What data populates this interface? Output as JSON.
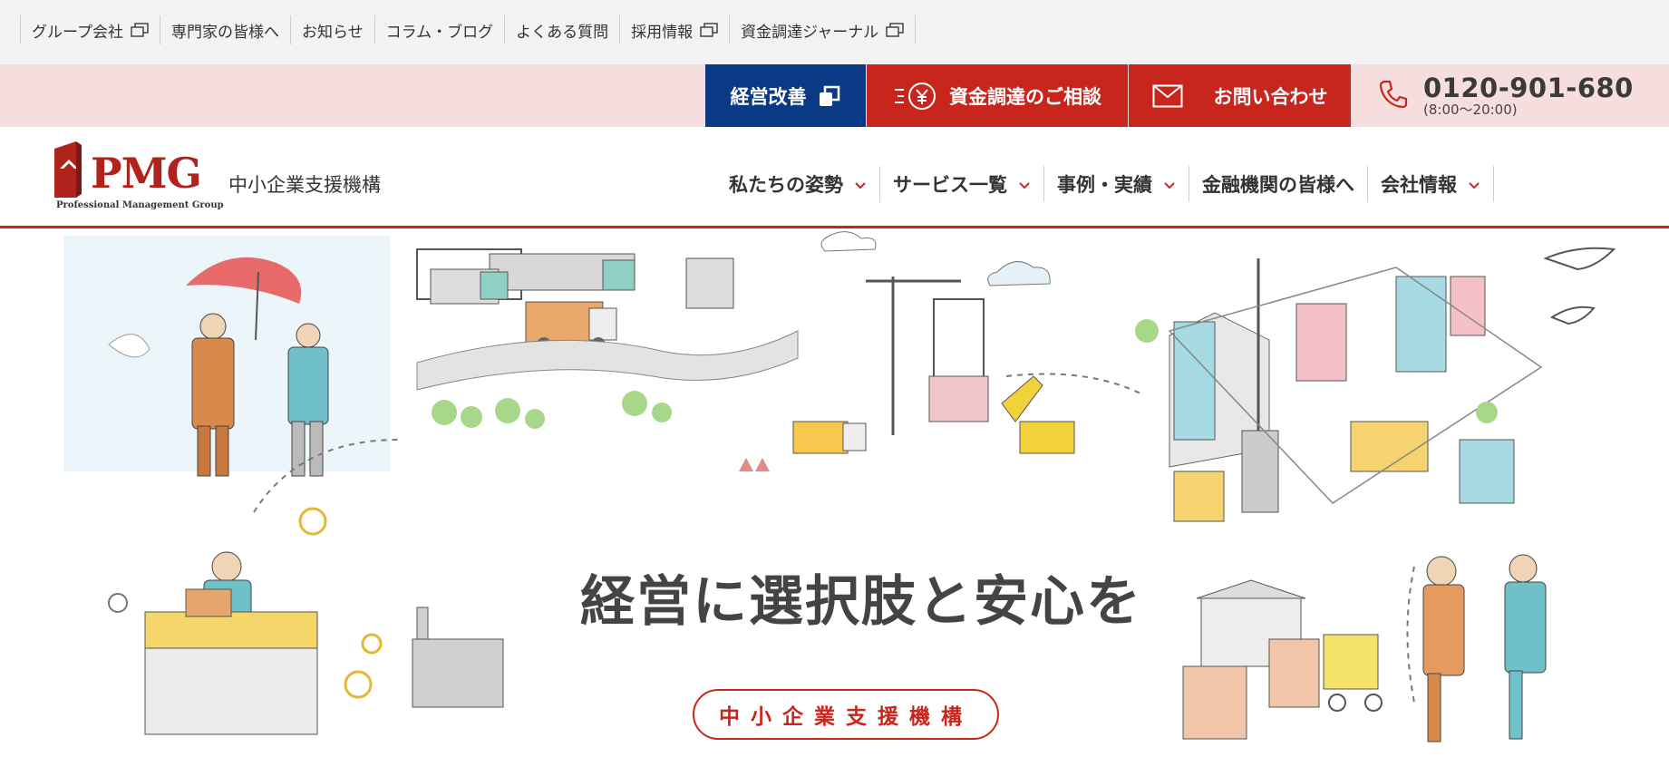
{
  "utility_nav": [
    {
      "label": "グループ会社",
      "external": true
    },
    {
      "label": "専門家の皆様へ",
      "external": false
    },
    {
      "label": "お知らせ",
      "external": false
    },
    {
      "label": "コラム・ブログ",
      "external": false
    },
    {
      "label": "よくある質問",
      "external": false
    },
    {
      "label": "採用情報",
      "external": true
    },
    {
      "label": "資金調達ジャーナル",
      "external": true
    }
  ],
  "cta": {
    "management": "経営改善",
    "funding": "資金調達のご相談",
    "contact": "お問い合わせ",
    "phone_number": "0120-901-680",
    "phone_hours": "(8:00〜20:00)"
  },
  "logo": {
    "word": "PMG",
    "sub": "Professional Management Group"
  },
  "tagline": "中小企業支援機構",
  "main_nav": [
    {
      "label": "私たちの姿勢",
      "dropdown": true
    },
    {
      "label": "サービス一覧",
      "dropdown": true
    },
    {
      "label": "事例・実績",
      "dropdown": true
    },
    {
      "label": "金融機関の皆様へ",
      "dropdown": false
    },
    {
      "label": "会社情報",
      "dropdown": true
    }
  ],
  "hero": {
    "headline": "経営に選択肢と安心を",
    "pill": "中小企業支援機構"
  },
  "colors": {
    "brand_red": "#c8261d",
    "navy": "#0a3a86",
    "pink_band": "#f6dede"
  }
}
